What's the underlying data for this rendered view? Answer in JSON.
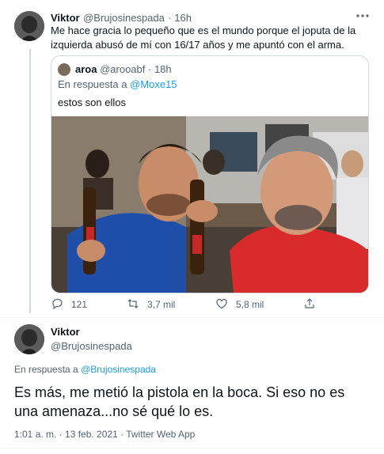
{
  "tweet1": {
    "name": "Viktor",
    "handle": "@Brujosinespada",
    "time": "· 16h",
    "text": "Me hace gracia lo pequeño que es el mundo porque el joputa de la izquierda abusó de mí con 16/17 años y me apuntó con el arma."
  },
  "quoted": {
    "name": "aroa",
    "handle": "@arooabf",
    "time": "· 18h",
    "reply_prefix": "En respuesta a",
    "reply_to": "@Moxe15",
    "text": "estos son ellos"
  },
  "actions": {
    "replies": "121",
    "retweets": "3,7 mil",
    "likes": "5,8 mil"
  },
  "tweet2": {
    "name": "Viktor",
    "handle": "@Brujosinespada",
    "reply_prefix": "En respuesta a",
    "reply_to": "@Brujosinespada",
    "text": "Es más, me metió la pistola en la boca. Si eso no es una amenaza...no sé qué lo es.",
    "timestamp": "1:01 a. m. · 13 feb. 2021 · Twitter Web App"
  },
  "icons": [
    "more-icon",
    "reply-icon",
    "retweet-icon",
    "like-icon",
    "share-icon"
  ]
}
